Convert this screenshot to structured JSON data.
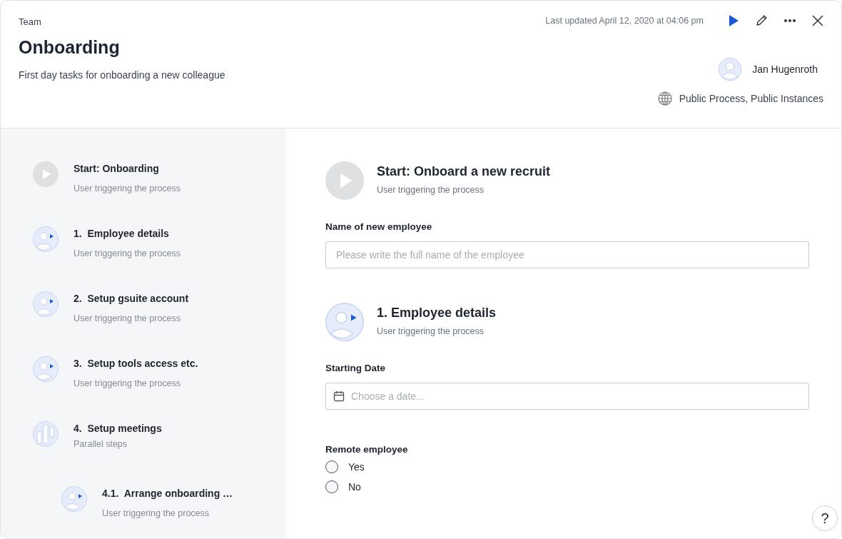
{
  "header": {
    "team": "Team",
    "title": "Onboarding",
    "description": "First day tasks for onboarding a new colleague",
    "last_updated": "Last updated April 12, 2020 at 04:06 pm",
    "owner": "Jan Hugenroth",
    "visibility": "Public Process, Public Instances"
  },
  "steps": [
    {
      "kind": "start",
      "title": "Start: Onboarding",
      "subtitle": "User triggering the process"
    },
    {
      "kind": "user",
      "number": "1.",
      "title": "Employee details",
      "subtitle": "User triggering the process"
    },
    {
      "kind": "user",
      "number": "2.",
      "title": "Setup gsuite account",
      "subtitle": "User triggering the process"
    },
    {
      "kind": "user",
      "number": "3.",
      "title": "Setup tools access etc.",
      "subtitle": "User triggering the process"
    },
    {
      "kind": "parallel",
      "number": "4.",
      "title": "Setup meetings",
      "subtitle": "Parallel steps",
      "children": [
        {
          "kind": "user",
          "number": "4.1.",
          "title": "Arrange onboarding …",
          "subtitle": "User triggering the process"
        }
      ]
    }
  ],
  "form": [
    {
      "kind": "start_step",
      "title": "Start: Onboard a new recruit",
      "subtitle": "User triggering the process"
    },
    {
      "kind": "text",
      "label": "Name of new employee",
      "placeholder": "Please write the full name of the employee"
    },
    {
      "kind": "user_step",
      "title": "1. Employee details",
      "subtitle": "User triggering the process"
    },
    {
      "kind": "date",
      "label": "Starting Date",
      "placeholder": "Choose a date..."
    },
    {
      "kind": "radio",
      "label": "Remote employee",
      "options": [
        {
          "label": "Yes",
          "selected": false
        },
        {
          "label": "No",
          "selected": false
        }
      ]
    }
  ],
  "help": "?"
}
